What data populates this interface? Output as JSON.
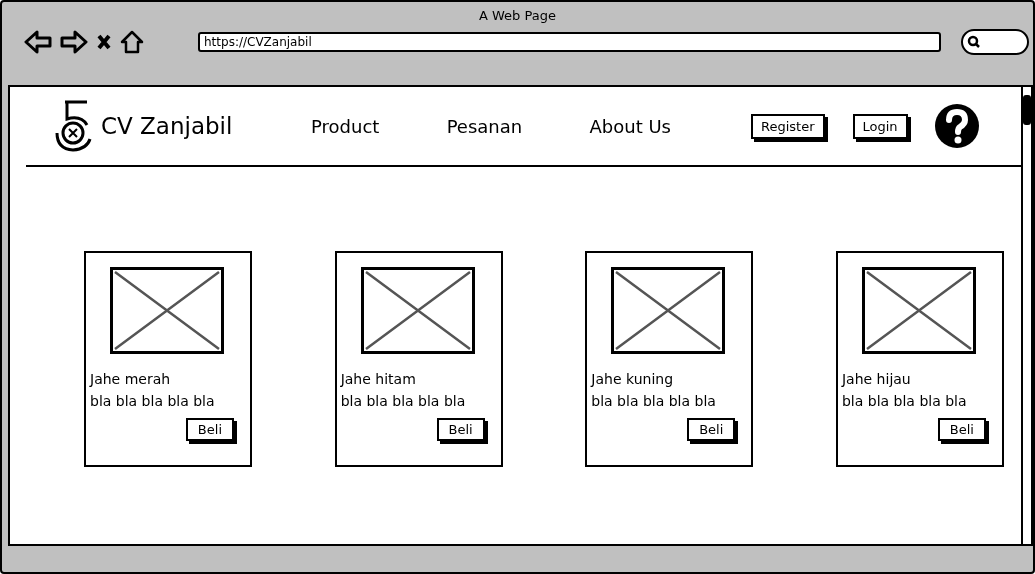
{
  "window": {
    "title": "A Web Page",
    "url": "https://CVZanjabil"
  },
  "header": {
    "brand": "CV Zanjabil",
    "nav": [
      "Product",
      "Pesanan",
      "About Us"
    ],
    "buttons": [
      "Register",
      "Login"
    ]
  },
  "products": [
    {
      "name": "Jahe merah",
      "description": "bla bla bla bla bla",
      "button": "Beli"
    },
    {
      "name": "Jahe hitam",
      "description": "bla bla bla bla bla",
      "button": "Beli"
    },
    {
      "name": "Jahe kuning",
      "description": "bla bla bla bla bla",
      "button": "Beli"
    },
    {
      "name": "Jahe hijau",
      "description": "bla bla bla bla bla",
      "button": "Beli"
    }
  ]
}
